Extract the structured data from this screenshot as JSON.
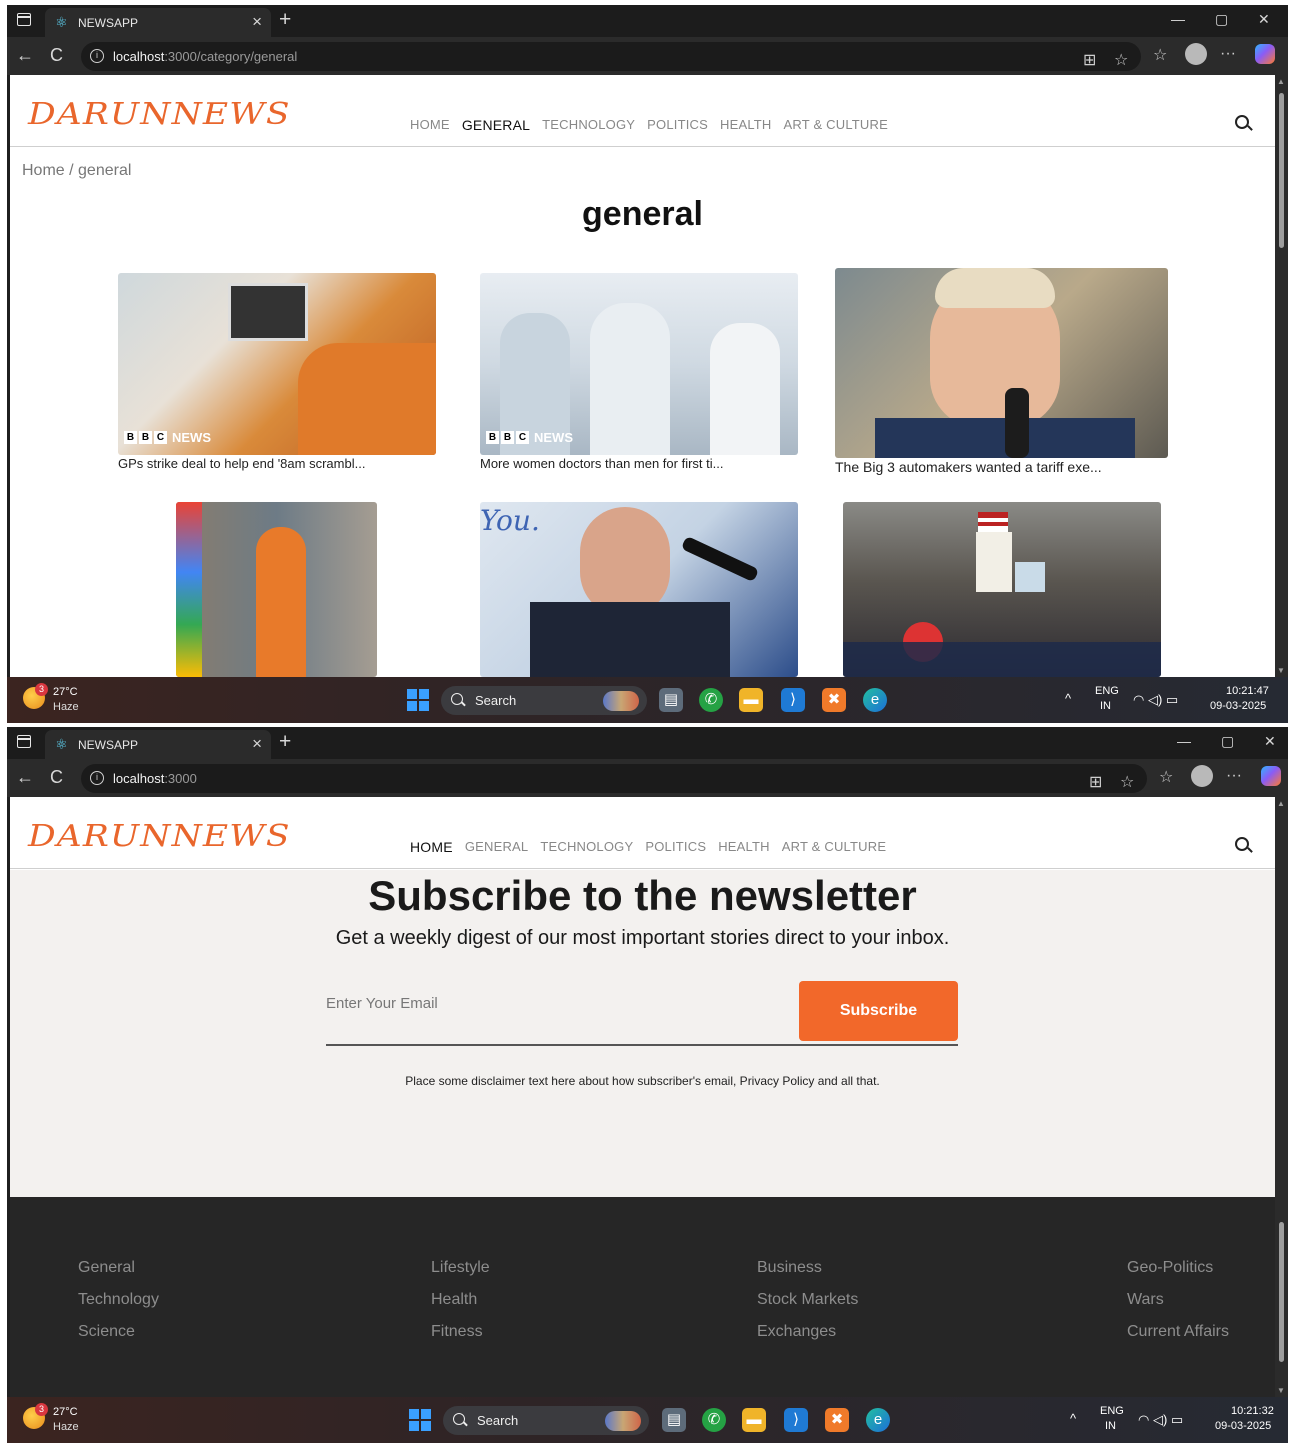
{
  "browser": {
    "tab_title": "NEWSAPP",
    "tab_close": "×",
    "new_tab": "+",
    "window_controls": [
      "—",
      "▢",
      "✕"
    ],
    "back": "←",
    "refresh": "C",
    "info": "i",
    "more": "···",
    "icons": [
      "window-menu-icon",
      "react-favicon-icon",
      "back-icon",
      "refresh-icon",
      "info-icon",
      "read-mode-icon",
      "favorite-star-icon",
      "favorites-icon",
      "profile-icon",
      "more-icon",
      "copilot-icon"
    ]
  },
  "screen1": {
    "url_host": "localhost",
    "url_path": ":3000/category/general",
    "breadcrumb": "Home / general",
    "page_title": "general",
    "cards": [
      {
        "caption": "GPs strike deal to help end '8am scrambl...",
        "badge": "NEWS"
      },
      {
        "caption": "More women doctors than men for first ti...",
        "badge": "NEWS"
      },
      {
        "caption": "The Big 3 automakers wanted a tariff exe...",
        "badge": ""
      }
    ],
    "taskbar": {
      "time": "10:21:47",
      "date": "09-03-2025"
    }
  },
  "screen2": {
    "url_host": "localhost",
    "url_path": ":3000",
    "newsletter": {
      "title": "Subscribe to the newsletter",
      "subtitle": "Get a weekly digest of our most important stories direct to your inbox.",
      "email_placeholder": "Enter Your Email",
      "button": "Subscribe",
      "disclaimer": "Place some disclaimer text here about how subscriber's email, Privacy Policy and all that."
    },
    "footer": {
      "col1": [
        "General",
        "Technology",
        "Science"
      ],
      "col2": [
        "Lifestyle",
        "Health",
        "Fitness"
      ],
      "col3": [
        "Business",
        "Stock Markets",
        "Exchanges"
      ],
      "col4": [
        "Geo-Politics",
        "Wars",
        "Current Affairs"
      ]
    },
    "taskbar": {
      "time": "10:21:32",
      "date": "09-03-2025"
    }
  },
  "site": {
    "logo": "DARUNNEWS",
    "nav": [
      "HOME",
      "GENERAL",
      "TECHNOLOGY",
      "POLITICS",
      "HEALTH",
      "ART & CULTURE"
    ]
  },
  "bbc_letters": [
    "B",
    "B",
    "C"
  ],
  "taskbar": {
    "weather_badge": "3",
    "temperature": "27°C",
    "condition": "Haze",
    "search": "Search",
    "lang": "ENG",
    "region": "IN",
    "tray_up": "^",
    "apps": [
      "file-explorer-icon",
      "whatsapp-icon",
      "folder-icon",
      "vscode-icon",
      "xampp-icon",
      "edge-icon"
    ]
  },
  "colors": {
    "accent": "#f2682a",
    "logo": "#e9662c",
    "footer_bg": "#262626",
    "newsletter_bg": "#f3f1ef"
  }
}
